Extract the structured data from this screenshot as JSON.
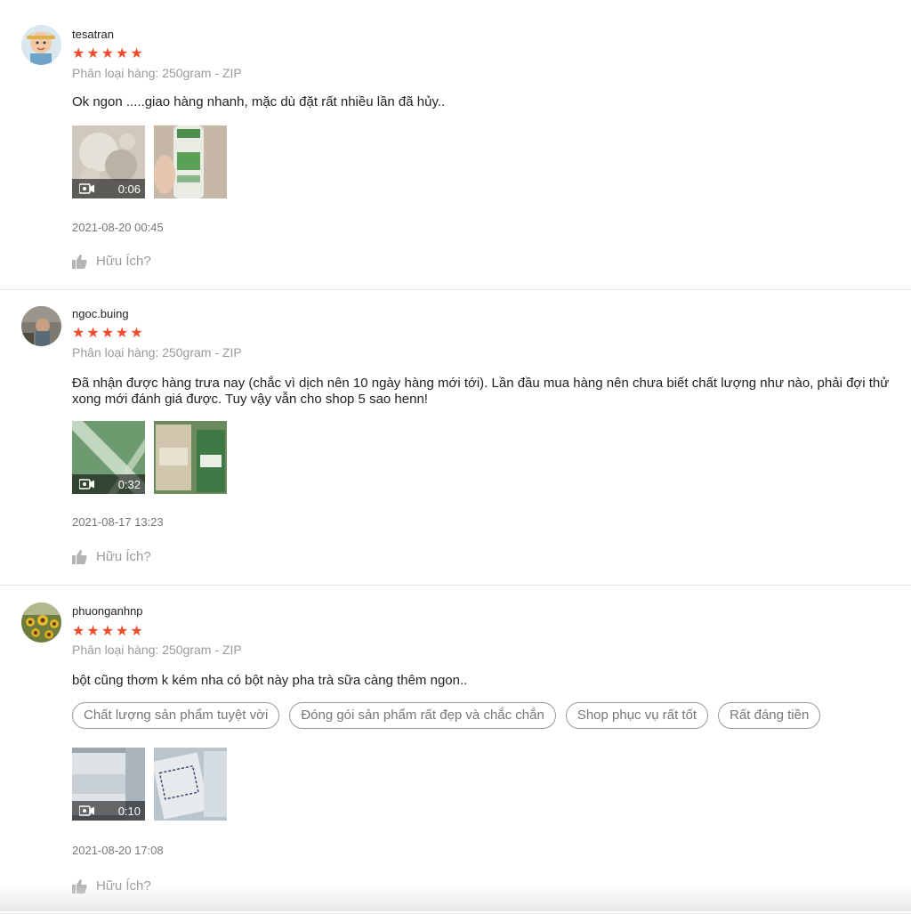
{
  "rating_color": "#ee4d2d",
  "reviews": [
    {
      "username": "tesatran",
      "stars": 5,
      "variation": "Phân loại hàng: 250gram - ZIP",
      "comment": "Ok ngon .....giao hàng nhanh, mặc dù đặt rất nhiều lần đã hủy..",
      "video_duration": "0:06",
      "date": "2021-08-20 00:45",
      "helpful_label": "Hữu Ích?"
    },
    {
      "username": "ngoc.buing",
      "stars": 5,
      "variation": "Phân loại hàng: 250gram - ZIP",
      "comment": "Đã nhận được hàng trưa nay (chắc vì dịch nên 10 ngày hàng mới tới). Lần đầu mua hàng nên chưa biết chất lượng như nào, phải đợi thử xong mới đánh giá được. Tuy vậy vẫn cho shop 5 sao henn!",
      "video_duration": "0:32",
      "date": "2021-08-17 13:23",
      "helpful_label": "Hữu Ích?"
    },
    {
      "username": "phuonganhnp",
      "stars": 5,
      "variation": "Phân loại hàng: 250gram - ZIP",
      "comment": "bột cũng thơm k kém nha có bột này pha trà sữa càng thêm ngon..",
      "tags": [
        "Chất lượng sản phẩm tuyệt vời",
        "Đóng gói sản phẩm rất đẹp và chắc chắn",
        "Shop phục vụ rất tốt",
        "Rất đáng tiền"
      ],
      "video_duration": "0:10",
      "date": "2021-08-20 17:08",
      "helpful_label": "Hữu Ích?"
    }
  ]
}
